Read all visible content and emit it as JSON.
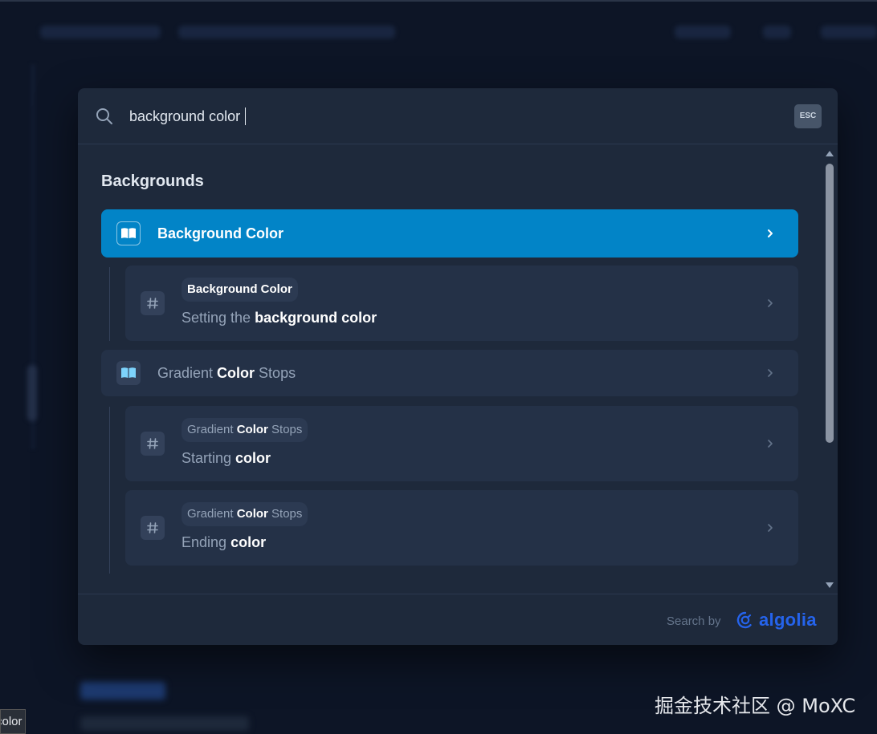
{
  "search": {
    "value": "background color",
    "esc_label": "ESC"
  },
  "section": {
    "title": "Backgrounds"
  },
  "hits": {
    "primary": {
      "title": "Background Color",
      "icon": "book-icon"
    },
    "sub1": {
      "crumb": "Background Color",
      "title_pre": "Setting the ",
      "title_bold": "background color",
      "icon": "hash-icon"
    },
    "primary2": {
      "title_pre": "Gradient ",
      "title_bold": "Color",
      "title_post": " Stops",
      "icon": "book-icon"
    },
    "sub2": {
      "crumb_pre": "Gradient ",
      "crumb_bold": "Color",
      "crumb_post": " Stops",
      "title_pre": "Starting ",
      "title_bold": "color",
      "icon": "hash-icon"
    },
    "sub3": {
      "crumb_pre": "Gradient ",
      "crumb_bold": "Color",
      "crumb_post": " Stops",
      "title_pre": "Ending ",
      "title_bold": "color",
      "icon": "hash-icon"
    }
  },
  "footer": {
    "search_by": "Search by",
    "brand": "algolia"
  },
  "watermark": "掘金技术社区 @ MoXC",
  "tooltip": "color",
  "colors": {
    "accent": "#0284c7",
    "modal_bg": "#1e293b",
    "algolia_blue": "#2563eb"
  }
}
